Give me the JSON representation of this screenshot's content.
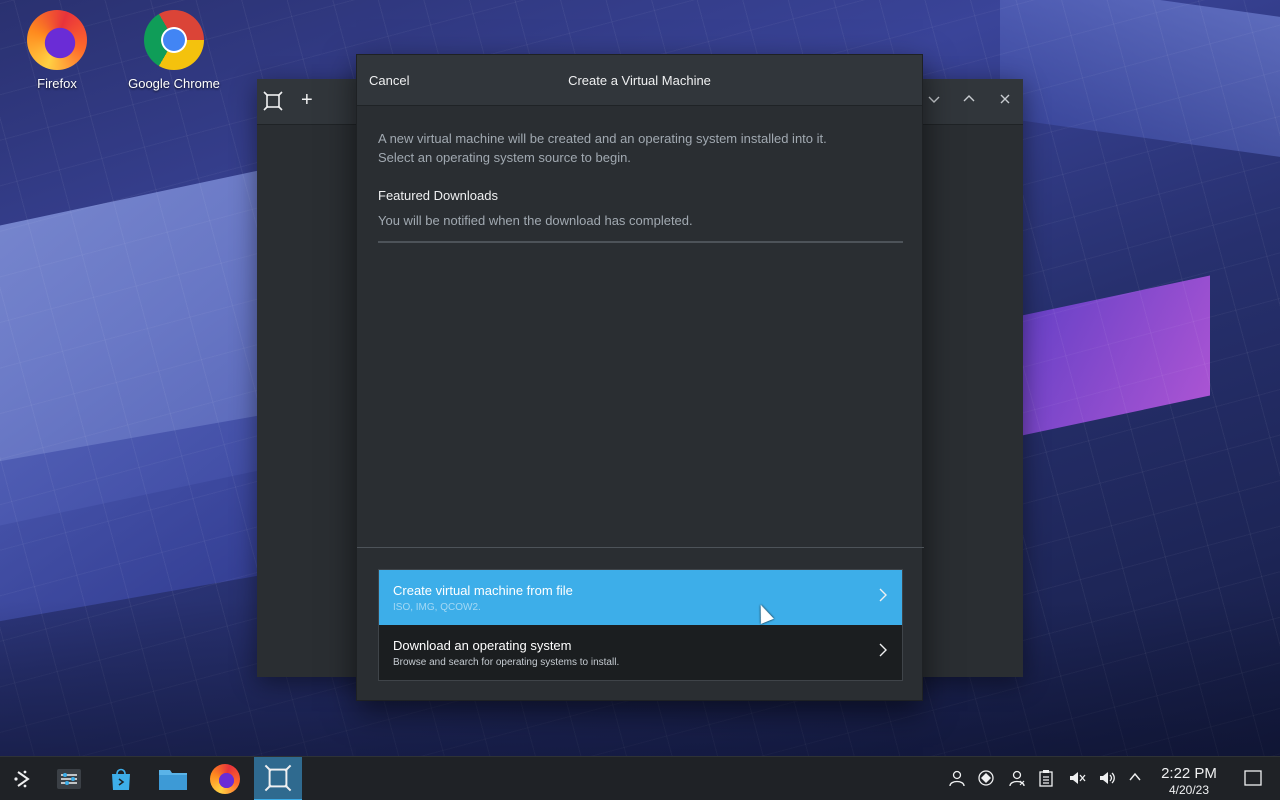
{
  "desktop": {
    "icons": [
      {
        "label": "Firefox",
        "icon": "firefox-icon"
      },
      {
        "label": "Google Chrome",
        "icon": "chrome-icon"
      }
    ]
  },
  "background_window": {
    "left_icons": [
      "app-icon",
      "add-icon"
    ],
    "right_controls": [
      "minimize",
      "maximize",
      "close"
    ]
  },
  "dialog": {
    "cancel_label": "Cancel",
    "title": "Create a Virtual Machine",
    "intro_line1": "A new virtual machine will be created and an operating system installed into it.",
    "intro_line2": "Select an operating system source to begin.",
    "featured_title": "Featured Downloads",
    "featured_subtitle": "You will be notified when the download has completed.",
    "options": [
      {
        "title": "Create virtual machine from file",
        "subtitle": "ISO, IMG, QCOW2.",
        "selected": true
      },
      {
        "title": "Download an operating system",
        "subtitle": "Browse and search for operating systems to install.",
        "selected": false
      }
    ]
  },
  "taskbar": {
    "apps": [
      "application-launcher-icon",
      "settings-icon",
      "discover-store-icon",
      "file-manager-icon",
      "firefox-icon",
      "gnome-boxes-icon"
    ],
    "active_app": "gnome-boxes-icon",
    "tray": [
      "user-icon",
      "network-icon",
      "accounts-icon",
      "clipboard-icon",
      "volume-muted-icon",
      "volume-icon",
      "expand-tray-icon"
    ],
    "time": "2:22 PM",
    "date": "4/20/23",
    "accent": "#3daee9"
  }
}
